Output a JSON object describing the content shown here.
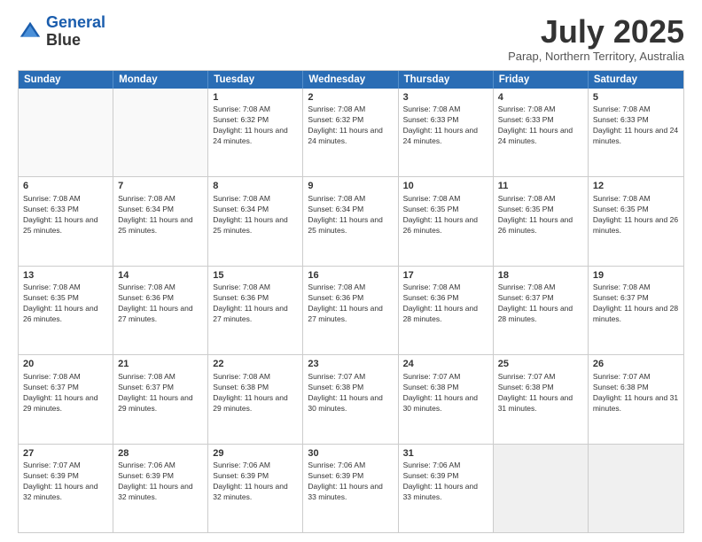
{
  "logo": {
    "line1": "General",
    "line2": "Blue"
  },
  "header": {
    "month": "July 2025",
    "location": "Parap, Northern Territory, Australia"
  },
  "days": [
    "Sunday",
    "Monday",
    "Tuesday",
    "Wednesday",
    "Thursday",
    "Friday",
    "Saturday"
  ],
  "weeks": [
    [
      {
        "day": "",
        "sunrise": "",
        "sunset": "",
        "daylight": ""
      },
      {
        "day": "",
        "sunrise": "",
        "sunset": "",
        "daylight": ""
      },
      {
        "day": "1",
        "sunrise": "Sunrise: 7:08 AM",
        "sunset": "Sunset: 6:32 PM",
        "daylight": "Daylight: 11 hours and 24 minutes."
      },
      {
        "day": "2",
        "sunrise": "Sunrise: 7:08 AM",
        "sunset": "Sunset: 6:32 PM",
        "daylight": "Daylight: 11 hours and 24 minutes."
      },
      {
        "day": "3",
        "sunrise": "Sunrise: 7:08 AM",
        "sunset": "Sunset: 6:33 PM",
        "daylight": "Daylight: 11 hours and 24 minutes."
      },
      {
        "day": "4",
        "sunrise": "Sunrise: 7:08 AM",
        "sunset": "Sunset: 6:33 PM",
        "daylight": "Daylight: 11 hours and 24 minutes."
      },
      {
        "day": "5",
        "sunrise": "Sunrise: 7:08 AM",
        "sunset": "Sunset: 6:33 PM",
        "daylight": "Daylight: 11 hours and 24 minutes."
      }
    ],
    [
      {
        "day": "6",
        "sunrise": "Sunrise: 7:08 AM",
        "sunset": "Sunset: 6:33 PM",
        "daylight": "Daylight: 11 hours and 25 minutes."
      },
      {
        "day": "7",
        "sunrise": "Sunrise: 7:08 AM",
        "sunset": "Sunset: 6:34 PM",
        "daylight": "Daylight: 11 hours and 25 minutes."
      },
      {
        "day": "8",
        "sunrise": "Sunrise: 7:08 AM",
        "sunset": "Sunset: 6:34 PM",
        "daylight": "Daylight: 11 hours and 25 minutes."
      },
      {
        "day": "9",
        "sunrise": "Sunrise: 7:08 AM",
        "sunset": "Sunset: 6:34 PM",
        "daylight": "Daylight: 11 hours and 25 minutes."
      },
      {
        "day": "10",
        "sunrise": "Sunrise: 7:08 AM",
        "sunset": "Sunset: 6:35 PM",
        "daylight": "Daylight: 11 hours and 26 minutes."
      },
      {
        "day": "11",
        "sunrise": "Sunrise: 7:08 AM",
        "sunset": "Sunset: 6:35 PM",
        "daylight": "Daylight: 11 hours and 26 minutes."
      },
      {
        "day": "12",
        "sunrise": "Sunrise: 7:08 AM",
        "sunset": "Sunset: 6:35 PM",
        "daylight": "Daylight: 11 hours and 26 minutes."
      }
    ],
    [
      {
        "day": "13",
        "sunrise": "Sunrise: 7:08 AM",
        "sunset": "Sunset: 6:35 PM",
        "daylight": "Daylight: 11 hours and 26 minutes."
      },
      {
        "day": "14",
        "sunrise": "Sunrise: 7:08 AM",
        "sunset": "Sunset: 6:36 PM",
        "daylight": "Daylight: 11 hours and 27 minutes."
      },
      {
        "day": "15",
        "sunrise": "Sunrise: 7:08 AM",
        "sunset": "Sunset: 6:36 PM",
        "daylight": "Daylight: 11 hours and 27 minutes."
      },
      {
        "day": "16",
        "sunrise": "Sunrise: 7:08 AM",
        "sunset": "Sunset: 6:36 PM",
        "daylight": "Daylight: 11 hours and 27 minutes."
      },
      {
        "day": "17",
        "sunrise": "Sunrise: 7:08 AM",
        "sunset": "Sunset: 6:36 PM",
        "daylight": "Daylight: 11 hours and 28 minutes."
      },
      {
        "day": "18",
        "sunrise": "Sunrise: 7:08 AM",
        "sunset": "Sunset: 6:37 PM",
        "daylight": "Daylight: 11 hours and 28 minutes."
      },
      {
        "day": "19",
        "sunrise": "Sunrise: 7:08 AM",
        "sunset": "Sunset: 6:37 PM",
        "daylight": "Daylight: 11 hours and 28 minutes."
      }
    ],
    [
      {
        "day": "20",
        "sunrise": "Sunrise: 7:08 AM",
        "sunset": "Sunset: 6:37 PM",
        "daylight": "Daylight: 11 hours and 29 minutes."
      },
      {
        "day": "21",
        "sunrise": "Sunrise: 7:08 AM",
        "sunset": "Sunset: 6:37 PM",
        "daylight": "Daylight: 11 hours and 29 minutes."
      },
      {
        "day": "22",
        "sunrise": "Sunrise: 7:08 AM",
        "sunset": "Sunset: 6:38 PM",
        "daylight": "Daylight: 11 hours and 29 minutes."
      },
      {
        "day": "23",
        "sunrise": "Sunrise: 7:07 AM",
        "sunset": "Sunset: 6:38 PM",
        "daylight": "Daylight: 11 hours and 30 minutes."
      },
      {
        "day": "24",
        "sunrise": "Sunrise: 7:07 AM",
        "sunset": "Sunset: 6:38 PM",
        "daylight": "Daylight: 11 hours and 30 minutes."
      },
      {
        "day": "25",
        "sunrise": "Sunrise: 7:07 AM",
        "sunset": "Sunset: 6:38 PM",
        "daylight": "Daylight: 11 hours and 31 minutes."
      },
      {
        "day": "26",
        "sunrise": "Sunrise: 7:07 AM",
        "sunset": "Sunset: 6:38 PM",
        "daylight": "Daylight: 11 hours and 31 minutes."
      }
    ],
    [
      {
        "day": "27",
        "sunrise": "Sunrise: 7:07 AM",
        "sunset": "Sunset: 6:39 PM",
        "daylight": "Daylight: 11 hours and 32 minutes."
      },
      {
        "day": "28",
        "sunrise": "Sunrise: 7:06 AM",
        "sunset": "Sunset: 6:39 PM",
        "daylight": "Daylight: 11 hours and 32 minutes."
      },
      {
        "day": "29",
        "sunrise": "Sunrise: 7:06 AM",
        "sunset": "Sunset: 6:39 PM",
        "daylight": "Daylight: 11 hours and 32 minutes."
      },
      {
        "day": "30",
        "sunrise": "Sunrise: 7:06 AM",
        "sunset": "Sunset: 6:39 PM",
        "daylight": "Daylight: 11 hours and 33 minutes."
      },
      {
        "day": "31",
        "sunrise": "Sunrise: 7:06 AM",
        "sunset": "Sunset: 6:39 PM",
        "daylight": "Daylight: 11 hours and 33 minutes."
      },
      {
        "day": "",
        "sunrise": "",
        "sunset": "",
        "daylight": ""
      },
      {
        "day": "",
        "sunrise": "",
        "sunset": "",
        "daylight": ""
      }
    ]
  ]
}
